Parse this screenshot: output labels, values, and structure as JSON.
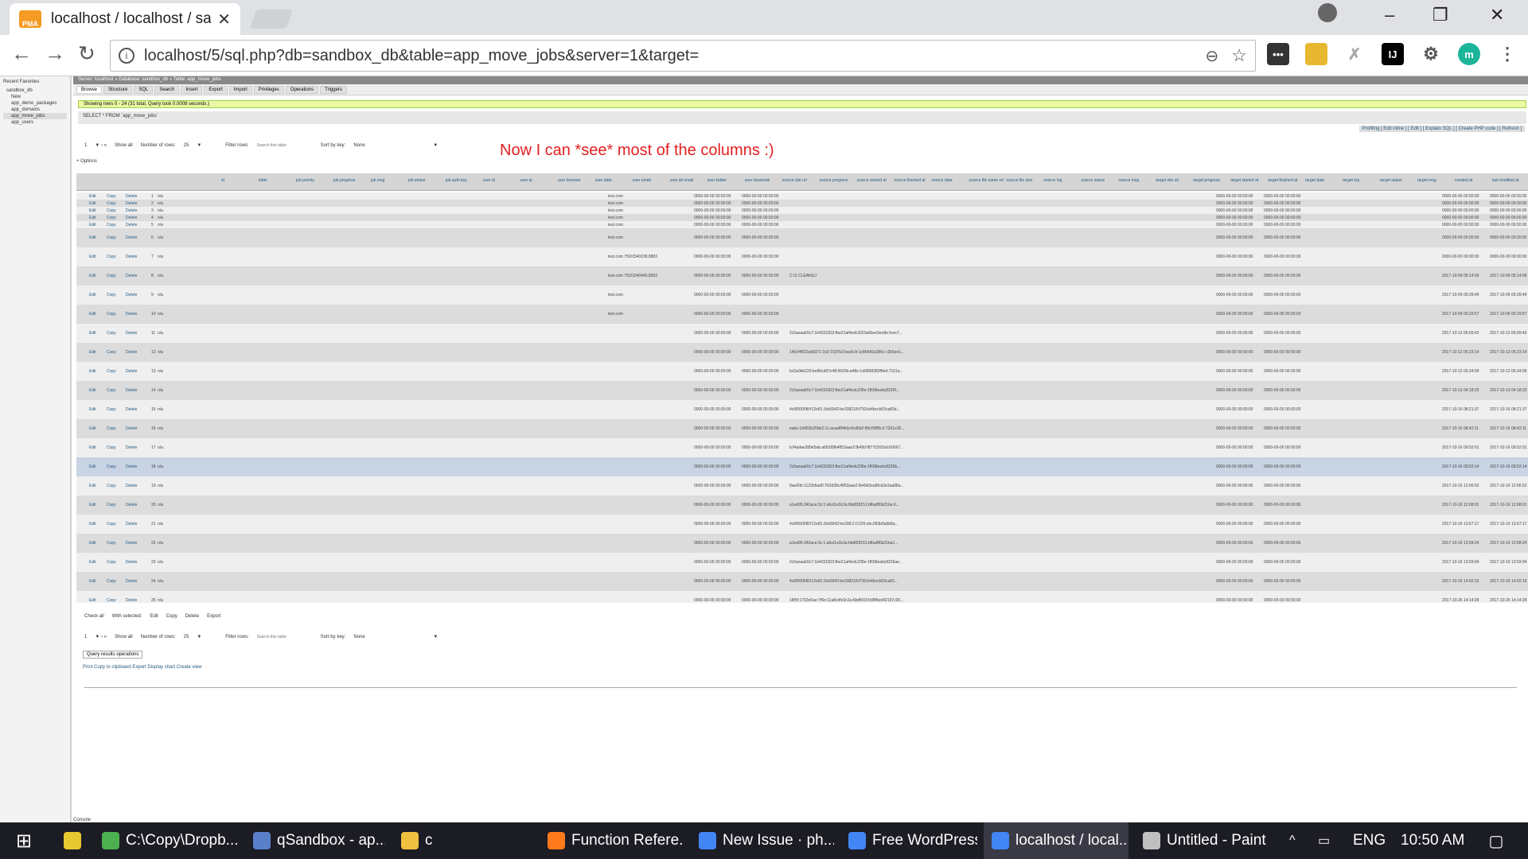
{
  "browser": {
    "tab_title": "localhost / localhost / sa",
    "url": "localhost/5/sql.php?db=sandbox_db&table=app_move_jobs&server=1&target="
  },
  "navpanel": {
    "header": "Recent  Favorites",
    "items": [
      "sandbox_db",
      "New",
      "app_demo_packages",
      "app_domains",
      "app_move_jobs",
      "app_users"
    ]
  },
  "main": {
    "breadcrumb": "Server: localhost » Database: sandbox_db » Table: app_move_jobs",
    "tabs": [
      "Browse",
      "Structure",
      "SQL",
      "Search",
      "Insert",
      "Export",
      "Import",
      "Privileges",
      "Operations",
      "Triggers"
    ],
    "success": "Showing rows 0 - 24 (31 total, Query took 0.0008 seconds.)",
    "sql": "SELECT * FROM `app_move_jobs`",
    "links": "Profiling [ Edit inline ] [ Edit ] [ Explain SQL ] [ Create PHP code ] [ Refresh ]",
    "paging": {
      "page": "1",
      "show_all": "Show all",
      "rows_label": "Number of rows:",
      "rows": "25",
      "filter_label": "Filter rows:",
      "filter_placeholder": "Search this table",
      "sort_label": "Sort by key:",
      "sort": "None"
    },
    "annotation": "Now I can *see* most of the columns :)",
    "options": "+ Options",
    "columns": [
      "id",
      "label",
      "job priority",
      "job progress",
      "job msg",
      "job status",
      "job auth key",
      "user id",
      "user ip",
      "user browser",
      "user data",
      "user email",
      "user alt email",
      "user twitter",
      "user facebook",
      "source site url",
      "source progress",
      "source started at",
      "source finished at",
      "source data",
      "source file name rel",
      "source file size",
      "source log",
      "source status",
      "source msg",
      "target site url",
      "target progress",
      "target started at",
      "target finished at",
      "target data",
      "target log",
      "target status",
      "target msg",
      "created at",
      "last modified at"
    ],
    "row_actions": {
      "edit": "Edit",
      "copy": "Copy",
      "delete": "Delete"
    },
    "rows": [
      {
        "id": "1",
        "label": "n/a",
        "url": "test.com",
        "date": "0000-00-00 00:00:00",
        "data": "",
        "created": "0000-00-00 00:00:00"
      },
      {
        "id": "2",
        "label": "n/a",
        "url": "test.com",
        "date": "0000-00-00 00:00:00",
        "data": "",
        "created": "0000-00-00 00:00:00"
      },
      {
        "id": "3",
        "label": "n/a",
        "url": "test.com",
        "date": "0000-00-00 00:00:00",
        "data": "",
        "created": "0000-00-00 00:00:00"
      },
      {
        "id": "4",
        "label": "n/a",
        "url": "test.com",
        "date": "0000-00-00 00:00:00",
        "data": "",
        "created": "0000-00-00 00:00:00"
      },
      {
        "id": "5",
        "label": "n/a",
        "url": "test.com",
        "date": "0000-00-00 00:00:00",
        "data": "",
        "created": "0000-00-00 00:00:00"
      },
      {
        "id": "6",
        "label": "n/a",
        "url": "test.com",
        "date": "0000-00-00 00:00:00",
        "data": "",
        "created": "0000-00-00 00:00:00"
      },
      {
        "id": "7",
        "label": "n/a",
        "url": "test.com 750/1540238.8883",
        "date": "0000-00-00 00:00:00",
        "data": "",
        "created": "0000-00-00 00:00:00"
      },
      {
        "id": "8",
        "label": "n/a",
        "url": "test.com 750/1540445.8352",
        "date": "0000-00-00 00:00:00",
        "data": "C:\\S CLEANUJ",
        "created": "2017-10-09 05:14:09"
      },
      {
        "id": "9",
        "label": "n/a",
        "url": "test.com",
        "date": "0000-00-00 00:00:00",
        "data": "",
        "created": "2017-10-09 05:28:49"
      },
      {
        "id": "10",
        "label": "n/a",
        "url": "test.com",
        "date": "0000-00-00 00:00:00",
        "data": "",
        "created": "2017-10-09 05:29:57"
      },
      {
        "id": "11",
        "label": "n/a",
        "url": "",
        "date": "0000-00-00 00:00:00",
        "data": "2c5aeaa60c7:1b4331823:fbe21af4edc2020a6bec5ee8e:fcee7...",
        "created": "2017-10-12 05:09:43"
      },
      {
        "id": "12",
        "label": "n/a",
        "url": "",
        "date": "0000-00-00 00:00:00",
        "data": "140cf4822ad0371:1b2:1637b2:bac6cb:1c8b942a396c:c2b5ee1...",
        "created": "2017-10-12 05:23:14"
      },
      {
        "id": "13",
        "label": "n/a",
        "url": "",
        "date": "0000-00-00 00:00:00",
        "data": "bc5a0bb229:be86cd87e48:0026b:a48e:1d0898383f8ed:7161a...",
        "created": "2017-10-12 05:34:09"
      },
      {
        "id": "14",
        "label": "n/a",
        "url": "",
        "date": "0000-00-00 00:00:00",
        "data": "2c5aeaa60c7:1b4331823:fbe21af4edc238e:1f658eabc8226f...",
        "created": "2017-10-13 04:18:33"
      },
      {
        "id": "15",
        "label": "n/a",
        "url": "",
        "date": "0000-00-00 00:00:00",
        "data": "4c6f0005f8:f12e81:3cb5942:be338218:f792cb4bccb53ca83d...",
        "created": "2017-10-16 08:21:37"
      },
      {
        "id": "16",
        "label": "n/a",
        "url": "",
        "date": "0000-00-00 00:00:00",
        "data": "eabe:1d453b26bb2:11:acaa8f4b0c4cd5b2:f8d:f08f5c3:7261e36...",
        "created": "2017-10-16 08:42:11"
      },
      {
        "id": "17",
        "label": "n/a",
        "url": "",
        "date": "0000-00-00 00:00:00",
        "data": "b:f4adae389e5ab:a6f2d9fb4853aae2:fb49d:f87:f1501bd:b0067...",
        "created": "2017-10-16 09:52:01"
      },
      {
        "id": "18",
        "label": "n/a",
        "url": "",
        "date": "0000-00-00 00:00:00",
        "data": "2c5aeaa60c7:1b4331823:fbe21af4edc238e:1f658eabc8226b...",
        "created": "2017-10-16 09:52:14"
      },
      {
        "id": "19",
        "label": "n/a",
        "url": "",
        "date": "0000-00-00 00:00:00",
        "data": "8ae60b:1122b5ad0:763d38c4853aae2:fb49d3ea8fcd3e3aa88a...",
        "created": "2017-10-16 12:06:52"
      },
      {
        "id": "20",
        "label": "n/a",
        "url": "",
        "date": "0000-00-00 00:00:00",
        "data": "a1ed95:342ace:3c:1:afcd1e3c2a:6bdf28151:bfba8f0b21be:6...",
        "created": "2017-10-16 12:08:01"
      },
      {
        "id": "21",
        "label": "n/a",
        "url": "",
        "date": "0000-00-00 00:00:00",
        "data": "4c6f0005f8:f12e81:3cb5942:be338:2:0:226:ebc283b6a6b8a...",
        "created": "2017-10-16 13:57:17"
      },
      {
        "id": "22",
        "label": "n/a",
        "url": "",
        "date": "0000-00-00 00:00:00",
        "data": "a1ed95:342ace:3c:1:afcd1e3c2a:6bdf28151:bfba8f0b21ba1...",
        "created": "2017-10-16 13:58:24"
      },
      {
        "id": "23",
        "label": "n/a",
        "url": "",
        "date": "0000-00-00 00:00:00",
        "data": "2c5aeaa60c7:1b4331823:fbe21af4edc238e:1f658eabc8226ae...",
        "created": "2017-10-16 13:59:04"
      },
      {
        "id": "24",
        "label": "n/a",
        "url": "",
        "date": "0000-00-00 00:00:00",
        "data": "4c6f0005f8:f12e81:3cb5942:be338218:f792cb4bccb53ca83...",
        "created": "2017-10-16 14:02:15"
      },
      {
        "id": "25",
        "label": "n/a",
        "url": "",
        "date": "0000-00-00 00:00:00",
        "data": "18f5f:1702e5ae:7f6e:11a8cdfe3c2a:6bdf003:b08f6ed42197c36...",
        "created": "2017-10-26 14:14:28"
      }
    ],
    "bottom": {
      "check_all": "Check all",
      "with_selected": "With selected:",
      "edit": "Edit",
      "copy": "Copy",
      "delete": "Delete",
      "export": "Export"
    },
    "ops_title": "Query results operations",
    "ops_links": "Print  Copy to clipboard  Export  Display chart  Create view",
    "console": "Console"
  },
  "taskbar": [
    {
      "label": "",
      "color": "#e8c830"
    },
    {
      "label": "C:\\Copy\\Dropb...",
      "color": "#4caf50"
    },
    {
      "label": "qSandbox - ap...",
      "color": "#5a7fc9"
    },
    {
      "label": "c",
      "color": "#f0c040"
    },
    {
      "label": "Function Refere...",
      "color": "#ff7a1a"
    },
    {
      "label": "New Issue · ph...",
      "color": "#4285f4"
    },
    {
      "label": "Free WordPress...",
      "color": "#4285f4"
    },
    {
      "label": "localhost / local...",
      "color": "#4285f4"
    },
    {
      "label": "Untitled - Paint",
      "color": "#c0c0c0"
    }
  ],
  "tray": {
    "lang": "ENG",
    "time": "10:50 AM"
  }
}
